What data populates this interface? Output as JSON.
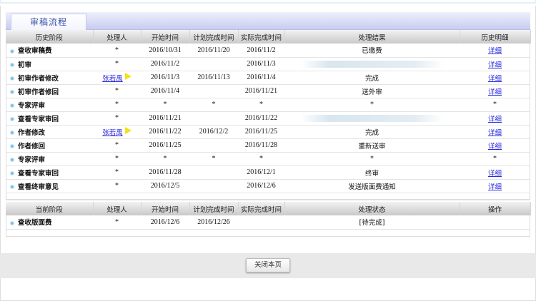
{
  "tab": {
    "label": "审稿流程"
  },
  "history": {
    "headers": [
      "历史阶段",
      "处理人",
      "开始时间",
      "计划完成时间",
      "实际完成时间",
      "处理结果",
      "历史明细"
    ],
    "rows": [
      {
        "stage": "查收审稿费",
        "handler": "*",
        "start": "2016/10/31",
        "planned": "2016/11/20",
        "actual": "2016/11/2",
        "result": "已缴费",
        "detail": "详细"
      },
      {
        "stage": "初审",
        "handler": "*",
        "start": "2016/11/2",
        "planned": "",
        "actual": "2016/11/3",
        "result": "",
        "redacted": true,
        "detail": "详细"
      },
      {
        "stage": "初审作者修改",
        "handler": "张若禹",
        "handler_link": true,
        "start": "2016/11/3",
        "planned": "2016/11/13",
        "actual": "2016/11/4",
        "result": "完成",
        "detail": "详细"
      },
      {
        "stage": "初审作者修回",
        "handler": "*",
        "start": "2016/11/4",
        "planned": "",
        "actual": "2016/11/21",
        "result": "送外审",
        "detail": "详细"
      },
      {
        "stage": "专家评审",
        "handler": "*",
        "start": "*",
        "planned": "*",
        "actual": "*",
        "result": "*",
        "detail": "*",
        "detail_plain": true
      },
      {
        "stage": "查看专家审回",
        "handler": "*",
        "start": "2016/11/21",
        "planned": "",
        "actual": "2016/11/22",
        "result": "",
        "redacted": true,
        "detail": "详细"
      },
      {
        "stage": "作者修改",
        "handler": "张若禹",
        "handler_link": true,
        "start": "2016/11/22",
        "planned": "2016/12/2",
        "actual": "2016/11/25",
        "result": "完成",
        "detail": "详细"
      },
      {
        "stage": "作者修回",
        "handler": "*",
        "start": "2016/11/25",
        "planned": "",
        "actual": "2016/11/28",
        "result": "重新送审",
        "detail": "详细"
      },
      {
        "stage": "专家评审",
        "handler": "*",
        "start": "*",
        "planned": "*",
        "actual": "*",
        "result": "*",
        "detail": "*",
        "detail_plain": true
      },
      {
        "stage": "查看专家审回",
        "handler": "*",
        "start": "2016/11/28",
        "planned": "",
        "actual": "2016/12/1",
        "result": "终审",
        "detail": "详细"
      },
      {
        "stage": "查看终审意见",
        "handler": "*",
        "start": "2016/12/5",
        "planned": "",
        "actual": "2016/12/6",
        "result": "发送版面费通知",
        "detail": "详细"
      }
    ]
  },
  "current": {
    "headers": [
      "当前阶段",
      "处理人",
      "开始时间",
      "计划完成时间",
      "实际完成时间",
      "处理状态",
      "操作"
    ],
    "rows": [
      {
        "stage": "查收版面费",
        "handler": "*",
        "start": "2016/12/6",
        "planned": "2016/12/26",
        "actual": "",
        "status": "[待完成]",
        "op": ""
      }
    ]
  },
  "footer": {
    "close_label": "关闭本页"
  }
}
